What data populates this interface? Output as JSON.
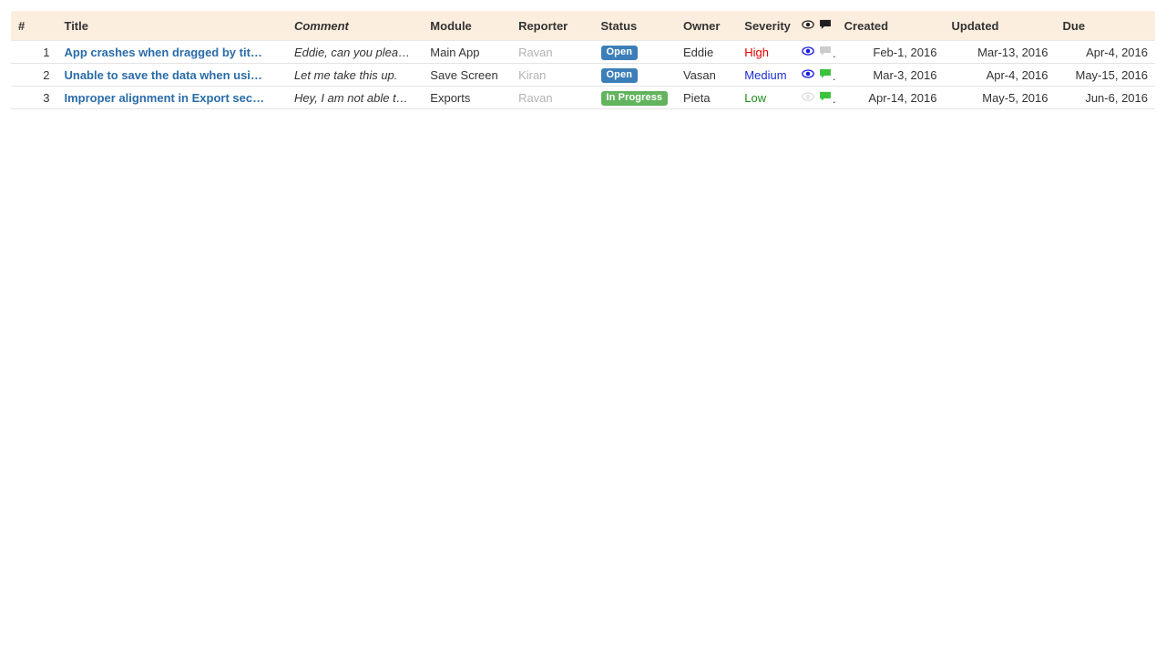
{
  "table": {
    "columns": [
      {
        "key": "num",
        "label": "#",
        "name": "column-header-number"
      },
      {
        "key": "title",
        "label": "Title",
        "name": "column-header-title"
      },
      {
        "key": "comment",
        "label": "Comment",
        "name": "column-header-comment"
      },
      {
        "key": "module",
        "label": "Module",
        "name": "column-header-module"
      },
      {
        "key": "reporter",
        "label": "Reporter",
        "name": "column-header-reporter"
      },
      {
        "key": "status",
        "label": "Status",
        "name": "column-header-status"
      },
      {
        "key": "owner",
        "label": "Owner",
        "name": "column-header-owner"
      },
      {
        "key": "severity",
        "label": "Severity",
        "name": "column-header-severity"
      },
      {
        "key": "icons",
        "label": "",
        "name": "column-header-icons"
      },
      {
        "key": "created",
        "label": "Created",
        "name": "column-header-created"
      },
      {
        "key": "updated",
        "label": "Updated",
        "name": "column-header-updated"
      },
      {
        "key": "due",
        "label": "Due",
        "name": "column-header-due"
      }
    ],
    "header_icons": [
      {
        "name": "eye-icon",
        "state": "dark"
      },
      {
        "name": "comment-icon",
        "state": "dark"
      }
    ],
    "rows": [
      {
        "num": "1",
        "title": "App crashes when dragged by tit…",
        "comment": "Eddie, can you plea…",
        "module": "Main App",
        "reporter": "Ravan",
        "status": "Open",
        "status_variant": "open",
        "owner": "Eddie",
        "severity": "High",
        "severity_variant": "high",
        "eye_state": "active",
        "comment_state": "inactive",
        "created": "Feb-1, 2016",
        "updated": "Mar-13, 2016",
        "due": "Apr-4, 2016"
      },
      {
        "num": "2",
        "title": "Unable to save the data when usi…",
        "comment": "Let me take this up.",
        "module": "Save Screen",
        "reporter": "Kiran",
        "status": "Open",
        "status_variant": "open",
        "owner": "Vasan",
        "severity": "Medium",
        "severity_variant": "medium",
        "eye_state": "active",
        "comment_state": "active",
        "created": "Mar-3, 2016",
        "updated": "Apr-4, 2016",
        "due": "May-15, 2016"
      },
      {
        "num": "3",
        "title": "Improper alignment in Export sec…",
        "comment": "Hey, I am not able t…",
        "module": "Exports",
        "reporter": "Ravan",
        "status": "In Progress",
        "status_variant": "inprogress",
        "owner": "Pieta",
        "severity": "Low",
        "severity_variant": "low",
        "eye_state": "inactive",
        "comment_state": "active",
        "created": "Apr-14, 2016",
        "updated": "May-5, 2016",
        "due": "Jun-6, 2016"
      }
    ]
  },
  "colors": {
    "header_background": "#fceede",
    "title_link": "#2a6ca8",
    "title_header": "#3b77b0",
    "reporter_muted": "#b3b3b3",
    "severity_high": "#e60000",
    "severity_medium": "#1a2ed6",
    "severity_low": "#1e8a1e",
    "badge_open": "#3c7fb8",
    "badge_inprogress": "#62b45e",
    "eye_active": "#1a1ad6",
    "comment_active": "#3cc23c",
    "comment_inactive": "#cccccc",
    "eye_inactive": "#dddddd",
    "row_border": "#e4e4e4"
  }
}
